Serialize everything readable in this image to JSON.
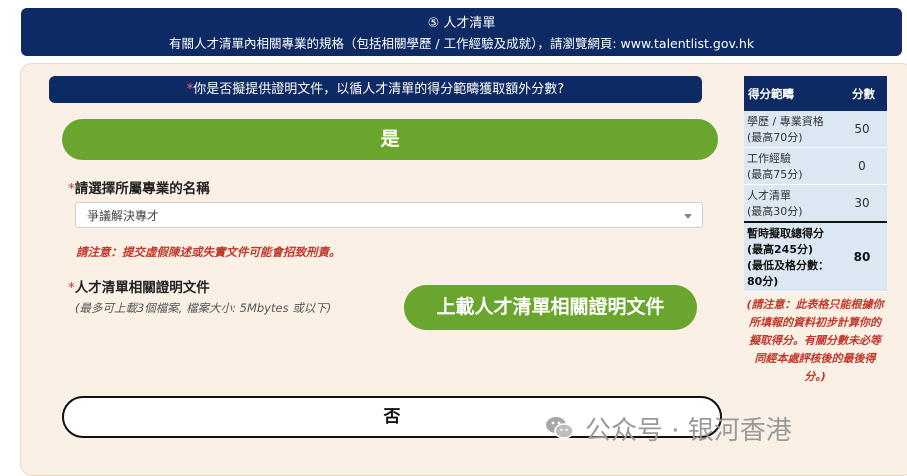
{
  "header": {
    "title": "⑤ 人才清單",
    "subtitle": "有關人才清單內相關專業的規格（包括相關學歷 / 工作經驗及成就），請瀏覽網頁: www.talentlist.gov.hk"
  },
  "question": {
    "required_mark": "*",
    "text": "你是否擬提供證明文件，以循人才清單的得分範疇獲取額外分數?"
  },
  "yes_button": "是",
  "profession": {
    "required_mark": "*",
    "label": "請選擇所屬專業的名稱",
    "selected": "爭議解決專才"
  },
  "warning": "請注意：提交虛假陳述或失實文件可能會招致刑責。",
  "upload": {
    "required_mark": "*",
    "label": "人才清單相關證明文件",
    "hint": "(最多可上載3個檔案, 檔案大小: 5Mbytes 或以下)",
    "button": "上載人才清單相關證明文件"
  },
  "no_button": "否",
  "score_table": {
    "header_category": "得分範疇",
    "header_score": "分數",
    "rows": [
      {
        "name": "學歷 / 專業資格",
        "max": "(最高70分)",
        "score": "50"
      },
      {
        "name": "工作經驗",
        "max": "(最高75分)",
        "score": "0"
      },
      {
        "name": "人才清單",
        "max": "(最高30分)",
        "score": "30"
      }
    ],
    "total": {
      "name": "暫時擬取總得分",
      "max": "(最高245分)",
      "min": "(最低及格分數：80分)",
      "score": "80"
    }
  },
  "note": "(請注意：此表格只能根據你所填報的資料初步計算你的擬取得分。有關分數未必等同經本處評核後的最後得分。)",
  "watermark": "公众号 · 银河香港",
  "colors": {
    "navy": "#0d2a64",
    "green": "#6aa62e",
    "warning_red": "#c0392b",
    "panel_bg": "#fbf0e6"
  }
}
